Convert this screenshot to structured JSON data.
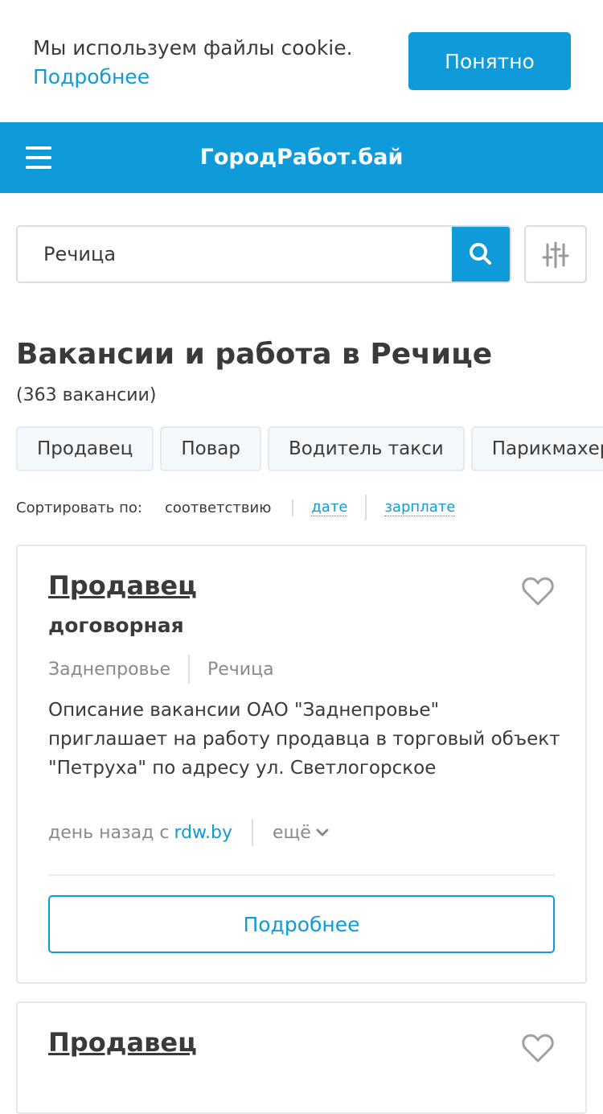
{
  "cookie": {
    "text": "Мы используем файлы cookie.",
    "more_link": "Подробнее",
    "accept_button": "Понятно"
  },
  "header": {
    "logo": "ГородРабот.бай",
    "menu_icon": "hamburger-menu-icon"
  },
  "search": {
    "value": "Речица",
    "search_icon": "search-icon",
    "filter_icon": "filter-sliders-icon"
  },
  "page": {
    "title": "Вакансии и работа в Речице",
    "count": "(363 вакансии)"
  },
  "chips": [
    "Продавец",
    "Повар",
    "Водитель такси",
    "Парикмахер"
  ],
  "sort": {
    "label": "Сортировать по:",
    "options": [
      "соответствию",
      "дате",
      "зарплате"
    ],
    "active": "соответствию"
  },
  "colors": {
    "accent": "#0f9bd9",
    "text": "#3a3a3a",
    "muted": "#8a8a8a"
  },
  "vacancies": [
    {
      "title": "Продавец",
      "salary": "договорная",
      "company": "Заднепровье",
      "city": "Речица",
      "description": "Описание вакансии ОАО \"Заднепровье\" приглашает на работу продавца в торговый объект \"Петруха\" по адресу ул. Светлогорское",
      "posted": "день назад с",
      "source": "rdw.by",
      "more": "ещё",
      "details_button": "Подробнее",
      "favorite_icon": "heart-outline-icon"
    },
    {
      "title": "Продавец",
      "favorite_icon": "heart-outline-icon"
    }
  ]
}
